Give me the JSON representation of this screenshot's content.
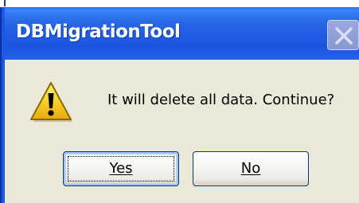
{
  "window": {
    "title": "DBMigrationTool"
  },
  "dialog": {
    "message": "It will delete all data. Continue?",
    "icon": "warning-icon",
    "buttons": {
      "yes_label": "Yes",
      "no_label": "No"
    }
  },
  "colors": {
    "titlebar": "#2563ea",
    "dialog_background": "#ece9d8",
    "close_button": "#8797d2",
    "warning_fill": "#f2c21a"
  }
}
